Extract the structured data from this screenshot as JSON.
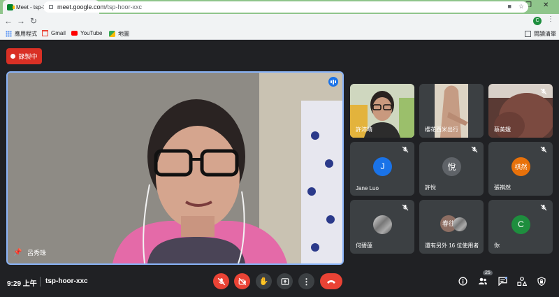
{
  "browser": {
    "tab_title": "Meet - tsp-hoor-xxc",
    "url_host": "meet.google.com",
    "url_path": "/tsp-hoor-xxc",
    "profile_initial": "C",
    "bookmarks": [
      {
        "label": "應用程式",
        "icon": "apps-icon"
      },
      {
        "label": "Gmail",
        "icon": "gmail-icon"
      },
      {
        "label": "YouTube",
        "icon": "youtube-icon"
      },
      {
        "label": "地圖",
        "icon": "maps-icon"
      }
    ],
    "reading_list": "閱讀清單"
  },
  "meet": {
    "recording_label": "錄製中",
    "main_speaker": "呂秀珠",
    "participants": [
      {
        "name": "許沛晴",
        "type": "video"
      },
      {
        "name": "櫻花西米出行",
        "type": "video"
      },
      {
        "name": "蔡美娥",
        "type": "video"
      },
      {
        "name": "Jane Luo",
        "initial": "J",
        "color": "#1a73e8"
      },
      {
        "name": "許悅",
        "initial": "悅",
        "color": "#5f6368"
      },
      {
        "name": "張祺然",
        "initial": "祺然",
        "color": "#e8710a"
      },
      {
        "name": "何碧蓮",
        "initial": "",
        "color": "photo"
      },
      {
        "name": "還有另外 16 位使用者",
        "initial": "春往",
        "color": "#8d6e63"
      },
      {
        "name": "你",
        "initial": "C",
        "color": "#1e8e3e"
      }
    ],
    "time": "9:29 上午",
    "meeting_code": "tsp-hoor-xxc",
    "participant_count": "25",
    "colors": {
      "accent": "#8ab4f8",
      "danger": "#ea4335",
      "bg": "#202124",
      "tile": "#3c4043"
    }
  }
}
